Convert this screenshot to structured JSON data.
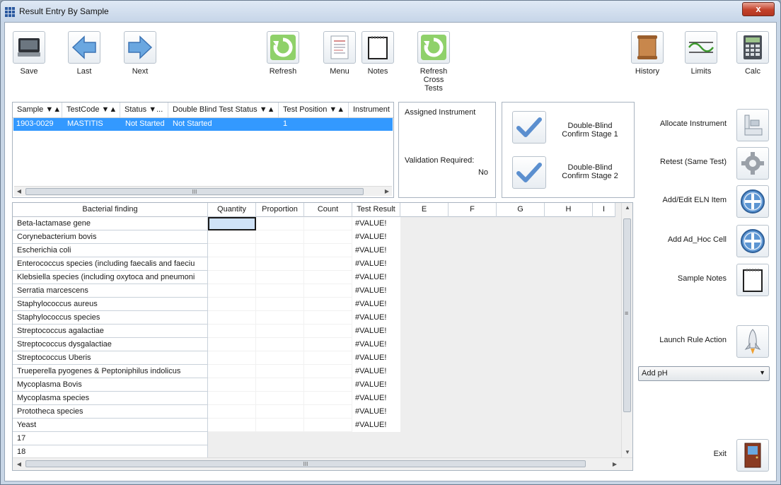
{
  "window": {
    "title": "Result Entry By Sample",
    "close_label": "x"
  },
  "toolbar": {
    "save": "Save",
    "last": "Last",
    "next": "Next",
    "refresh": "Refresh",
    "menu": "Menu",
    "notes": "Notes",
    "refresh_cross_1": "Refresh",
    "refresh_cross_2": "Cross",
    "refresh_cross_3": "Tests",
    "history": "History",
    "limits": "Limits",
    "calc": "Calc"
  },
  "sample_grid": {
    "headers": [
      "Sample ▼▲",
      "TestCode ▼▲",
      "Status ▼...",
      "Double Blind Test Status ▼▲",
      "Test Position ▼▲",
      "Instrument"
    ],
    "row": [
      "1903-0029",
      "MASTITIS",
      "Not Started",
      "Not Started",
      "1",
      ""
    ],
    "scroll_grip": "III"
  },
  "instrument_info": {
    "assigned_label": "Assigned Instrument",
    "validation_label": "Validation Required:",
    "validation_value": "No"
  },
  "double_blind": {
    "stage1_line1": "Double-Blind",
    "stage1_line2": "Confirm Stage 1",
    "stage2_line1": "Double-Blind",
    "stage2_line2": "Confirm Stage 2"
  },
  "result_grid": {
    "headers": [
      "Bacterial finding",
      "Quantity",
      "Proportion",
      "Count",
      "Test Result",
      "E",
      "F",
      "G",
      "H",
      "I"
    ],
    "rows": [
      {
        "finding": "Beta-lactamase gene",
        "result": "#VALUE!"
      },
      {
        "finding": "Corynebacterium bovis",
        "result": "#VALUE!"
      },
      {
        "finding": "Escherichia coli",
        "result": "#VALUE!"
      },
      {
        "finding": "Enterococcus species (including faecalis and faeciu",
        "result": "#VALUE!"
      },
      {
        "finding": "Klebsiella species (including oxytoca and pneumoni",
        "result": "#VALUE!"
      },
      {
        "finding": "Serratia marcescens",
        "result": "#VALUE!"
      },
      {
        "finding": "Staphylococcus aureus",
        "result": "#VALUE!"
      },
      {
        "finding": "Staphylococcus species",
        "result": "#VALUE!"
      },
      {
        "finding": "Streptococcus agalactiae",
        "result": "#VALUE!"
      },
      {
        "finding": "Streptococcus dysgalactiae",
        "result": "#VALUE!"
      },
      {
        "finding": "Streptococcus Uberis",
        "result": "#VALUE!"
      },
      {
        "finding": "Trueperella pyogenes & Peptoniphilus indolicus",
        "result": "#VALUE!"
      },
      {
        "finding": "Mycoplasma Bovis",
        "result": "#VALUE!"
      },
      {
        "finding": "Mycoplasma species",
        "result": "#VALUE!"
      },
      {
        "finding": "Prototheca species",
        "result": "#VALUE!"
      },
      {
        "finding": "Yeast",
        "result": "#VALUE!"
      },
      {
        "finding": "17",
        "result": ""
      },
      {
        "finding": "18",
        "result": ""
      }
    ],
    "scroll_grip": "III"
  },
  "actions": {
    "allocate_instrument": "Allocate Instrument",
    "retest": "Retest (Same Test)",
    "add_eln": "Add/Edit ELN Item",
    "add_adhoc": "Add Ad_Hoc Cell",
    "sample_notes": "Sample Notes",
    "launch_rule": "Launch Rule Action",
    "rule_select": "Add pH",
    "exit": "Exit"
  },
  "colors": {
    "selection": "#3399ff",
    "accent": "#2c5aa0",
    "green": "#3e9b2f"
  }
}
